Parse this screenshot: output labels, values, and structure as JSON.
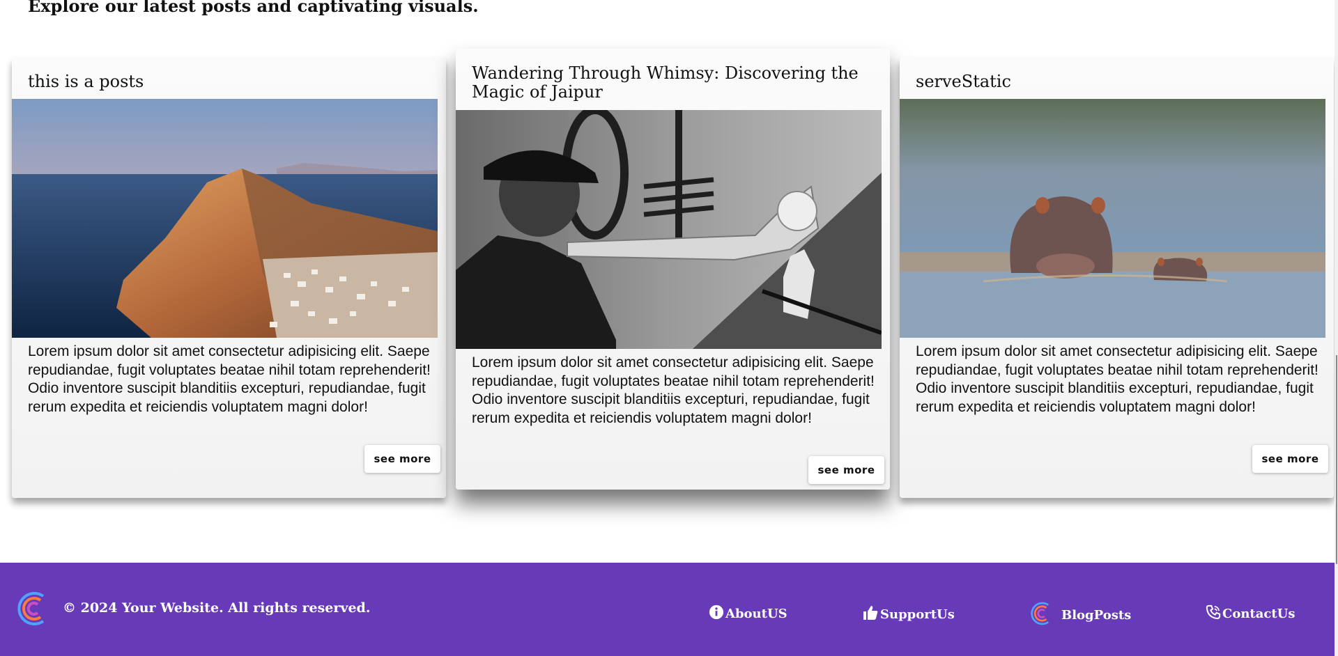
{
  "intro": "Explore our latest posts and captivating visuals.",
  "posts": [
    {
      "title": "this is a posts",
      "image": "coastal-cliff-village-photo",
      "body": "Lorem ipsum dolor sit amet consectetur adipisicing elit. Saepe repudiandae, fugit voluptates beatae nihil totam reprehenderit! Odio inventore suscipit blanditiis excepturi, repudiandae, fugit rerum expedita et reiciendis voluptatem magni dolor!",
      "button": "see more"
    },
    {
      "title": "Wandering Through Whimsy: Discovering the Magic of Jaipur",
      "image": "trumpet-player-photo",
      "body": "Lorem ipsum dolor sit amet consectetur adipisicing elit. Saepe repudiandae, fugit voluptates beatae nihil totam reprehenderit! Odio inventore suscipit blanditiis excepturi, repudiandae, fugit rerum expedita et reiciendis voluptatem magni dolor!",
      "button": "see more"
    },
    {
      "title": "serveStatic",
      "image": "hippos-in-water-photo",
      "body": "Lorem ipsum dolor sit amet consectetur adipisicing elit. Saepe repudiandae, fugit voluptates beatae nihil totam reprehenderit! Odio inventore suscipit blanditiis excepturi, repudiandae, fugit rerum expedita et reiciendis voluptatem magni dolor!",
      "button": "see more"
    }
  ],
  "footer": {
    "copyright": "© 2024 Your Website. All rights reserved.",
    "background": "#673ab7",
    "links": [
      {
        "label": "AboutUS",
        "icon": "info-icon"
      },
      {
        "label": "SupportUs",
        "icon": "thumbs-up-icon"
      },
      {
        "label": "BlogPosts",
        "icon": "logo-icon"
      },
      {
        "label": "ContactUs",
        "icon": "phone-icon"
      }
    ]
  }
}
